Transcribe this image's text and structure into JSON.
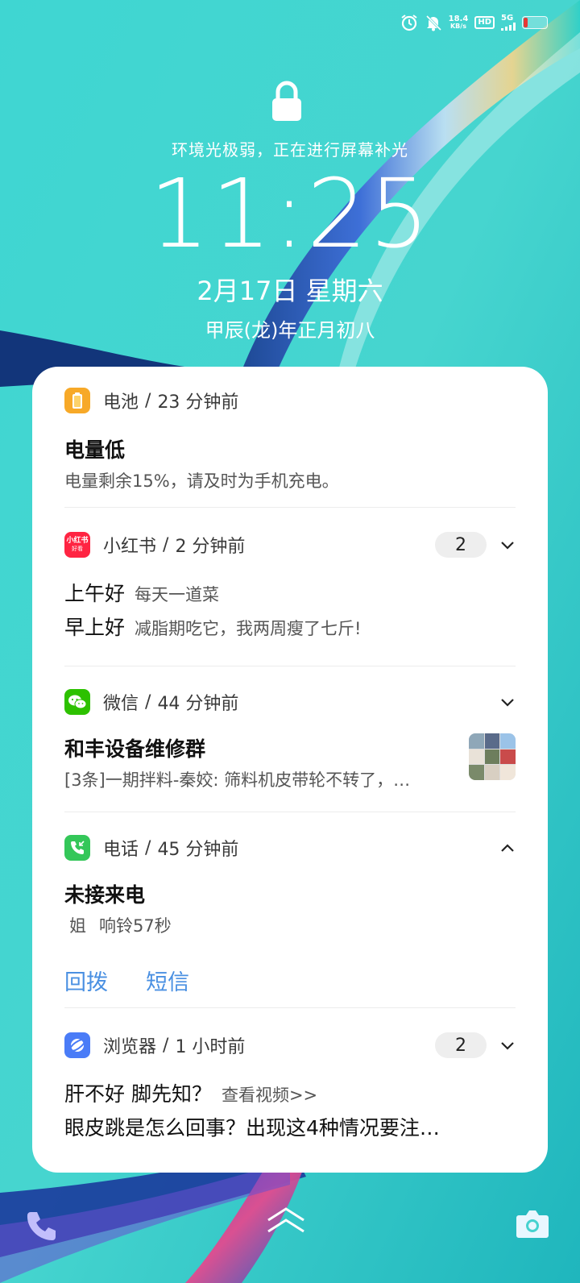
{
  "status_bar": {
    "net_speed_value": "18.4",
    "net_speed_unit": "KB/s",
    "hd_label": "HD",
    "network_label": "5G",
    "battery_level": 0.15,
    "icons": [
      "alarm-icon",
      "silent-bell-icon",
      "hd-icon",
      "signal-icon",
      "battery-icon"
    ]
  },
  "lockscreen": {
    "env_notice": "环境光极弱，正在进行屏幕补光",
    "time": "11:25",
    "date": "2月17日 星期六",
    "lunar_date": "甲辰(龙)年正月初八"
  },
  "notifications": [
    {
      "app": "电池",
      "sep": "/",
      "time": "23 分钟前",
      "title": "电量低",
      "body": "电量剩余15%，请及时为手机充电。",
      "icon": "battery-app-icon",
      "color": "#f7a928"
    },
    {
      "app": "小红书",
      "sep": "/",
      "time": "2 分钟前",
      "count": "2",
      "icon": "xiaohongshu-icon",
      "icon_text_top": "小红书",
      "icon_text_bottom": "好看",
      "lines": [
        {
          "title": "上午好",
          "text": "每天一道菜"
        },
        {
          "title": "早上好",
          "text": "减脂期吃它，我两周瘦了七斤!"
        }
      ],
      "color": "#ff2442"
    },
    {
      "app": "微信",
      "sep": "/",
      "time": "44 分钟前",
      "title": "和丰设备维修群",
      "body": "[3条]一期拌料-秦姣: 筛料机皮带轮不转了，…",
      "icon": "wechat-icon",
      "color": "#2dc100"
    },
    {
      "app": "电话",
      "sep": "/",
      "time": "45 分钟前",
      "title": "未接来电",
      "caller": "姐",
      "ring": "响铃57秒",
      "actions": [
        "回拨",
        "短信"
      ],
      "icon": "phone-app-icon",
      "color": "#34c759"
    },
    {
      "app": "浏览器",
      "sep": "/",
      "time": "1 小时前",
      "count": "2",
      "lines": [
        {
          "title": "肝不好 脚先知？",
          "text": "查看视频>>"
        }
      ],
      "body": "眼皮跳是怎么回事？出现这4种情况要注…",
      "icon": "browser-icon",
      "color": "#4a7cf7"
    }
  ],
  "bottom_bar": {
    "icons": [
      "phone-shortcut-icon",
      "swipe-up-icon",
      "camera-shortcut-icon"
    ]
  }
}
